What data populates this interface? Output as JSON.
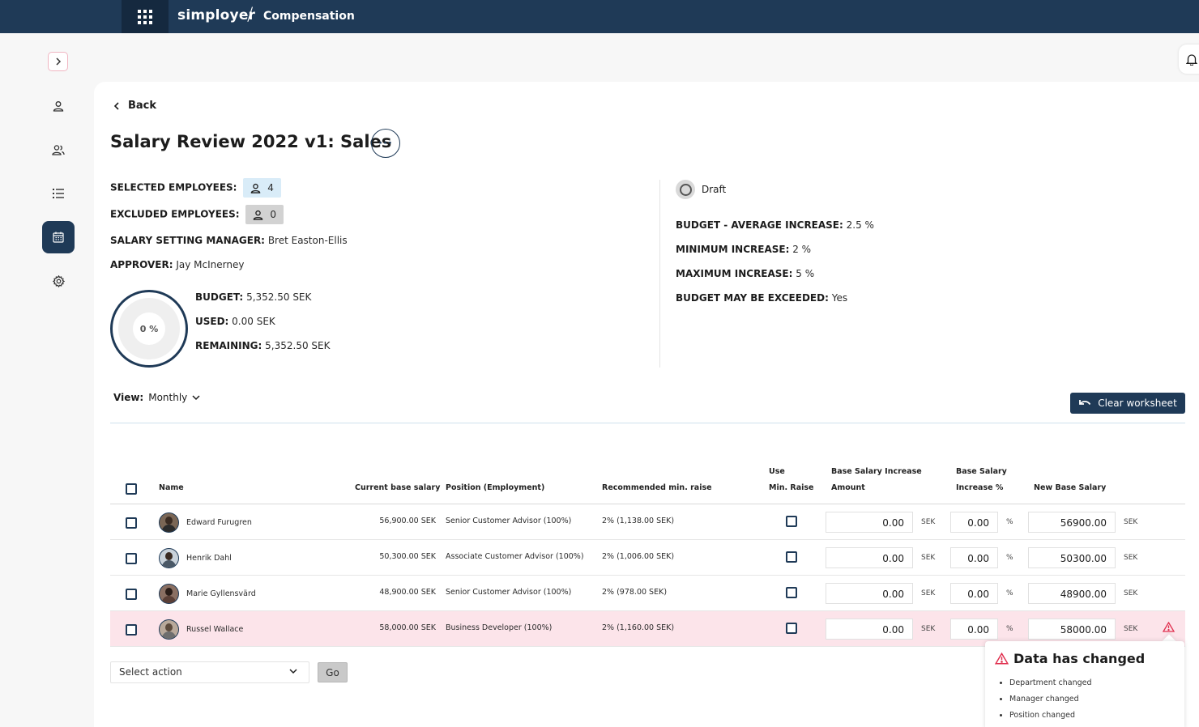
{
  "topbar": {
    "brand": "simployer",
    "separator": "/",
    "app_name": "Compensation"
  },
  "back_label": "Back",
  "page_title": "Salary Review 2022 v1: Sales",
  "more_label": "···",
  "summary": {
    "selected_label": "SELECTED EMPLOYEES:",
    "selected_count": "4",
    "excluded_label": "EXCLUDED EMPLOYEES:",
    "excluded_count": "0",
    "manager_label": "SALARY SETTING MANAGER:",
    "manager_value": "Bret Easton-Ellis",
    "approver_label": "APPROVER:",
    "approver_value": "Jay McInerney",
    "budget_label": "BUDGET:",
    "budget_value": "5,352.50 SEK",
    "used_label": "USED:",
    "used_value": "0.00 SEK",
    "remaining_label": "REMAINING:",
    "remaining_value": "5,352.50 SEK",
    "used_percent": "0 %"
  },
  "settings": {
    "status": "Draft",
    "avg_label": "BUDGET - AVERAGE INCREASE:",
    "avg_value": "2.5 %",
    "min_label": "MINIMUM INCREASE:",
    "min_value": "2 %",
    "max_label": "MAXIMUM INCREASE:",
    "max_value": "5 %",
    "exceed_label": "BUDGET MAY BE EXCEEDED:",
    "exceed_value": "Yes"
  },
  "view": {
    "label": "View:",
    "value": "Monthly"
  },
  "clear_worksheet": "Clear worksheet",
  "table": {
    "headers": {
      "name": "Name",
      "current": "Current base salary",
      "position": "Position (Employment)",
      "recommended": "Recommended min. raise",
      "use_min_1": "Use",
      "use_min_2": "Min. Raise",
      "amount_1": "Base Salary Increase",
      "amount_2": "Amount",
      "pct_1": "Base Salary",
      "pct_2": "Increase %",
      "new_salary": "New Base Salary"
    },
    "rows": [
      {
        "name": "Edward Furugren",
        "current": "56,900.00 SEK",
        "position": "Senior Customer Advisor (100%)",
        "recommended": "2% (1,138.00 SEK)",
        "amount": "0.00",
        "amount_unit": "SEK",
        "pct": "0.00",
        "pct_unit": "%",
        "new_salary": "56900.00",
        "new_unit": "SEK"
      },
      {
        "name": "Henrik Dahl",
        "current": "50,300.00 SEK",
        "position": "Associate Customer Advisor (100%)",
        "recommended": "2% (1,006.00 SEK)",
        "amount": "0.00",
        "amount_unit": "SEK",
        "pct": "0.00",
        "pct_unit": "%",
        "new_salary": "50300.00",
        "new_unit": "SEK"
      },
      {
        "name": "Marie Gyllensvärd",
        "current": "48,900.00 SEK",
        "position": "Senior Customer Advisor (100%)",
        "recommended": "2% (978.00 SEK)",
        "amount": "0.00",
        "amount_unit": "SEK",
        "pct": "0.00",
        "pct_unit": "%",
        "new_salary": "48900.00",
        "new_unit": "SEK"
      },
      {
        "name": "Russel Wallace",
        "current": "58,000.00 SEK",
        "position": "Business Developer (100%)",
        "recommended": "2% (1,160.00 SEK)",
        "amount": "0.00",
        "amount_unit": "SEK",
        "pct": "0.00",
        "pct_unit": "%",
        "new_salary": "58000.00",
        "new_unit": "SEK"
      }
    ]
  },
  "bulk": {
    "select_placeholder": "Select action",
    "go": "Go"
  },
  "tooltip": {
    "title": "Data has changed",
    "items": [
      "Department changed",
      "Manager changed",
      "Position changed"
    ]
  },
  "colors": {
    "navy": "#1f3a57",
    "alert_row": "#fce4ea",
    "warning": "#e0304f"
  }
}
